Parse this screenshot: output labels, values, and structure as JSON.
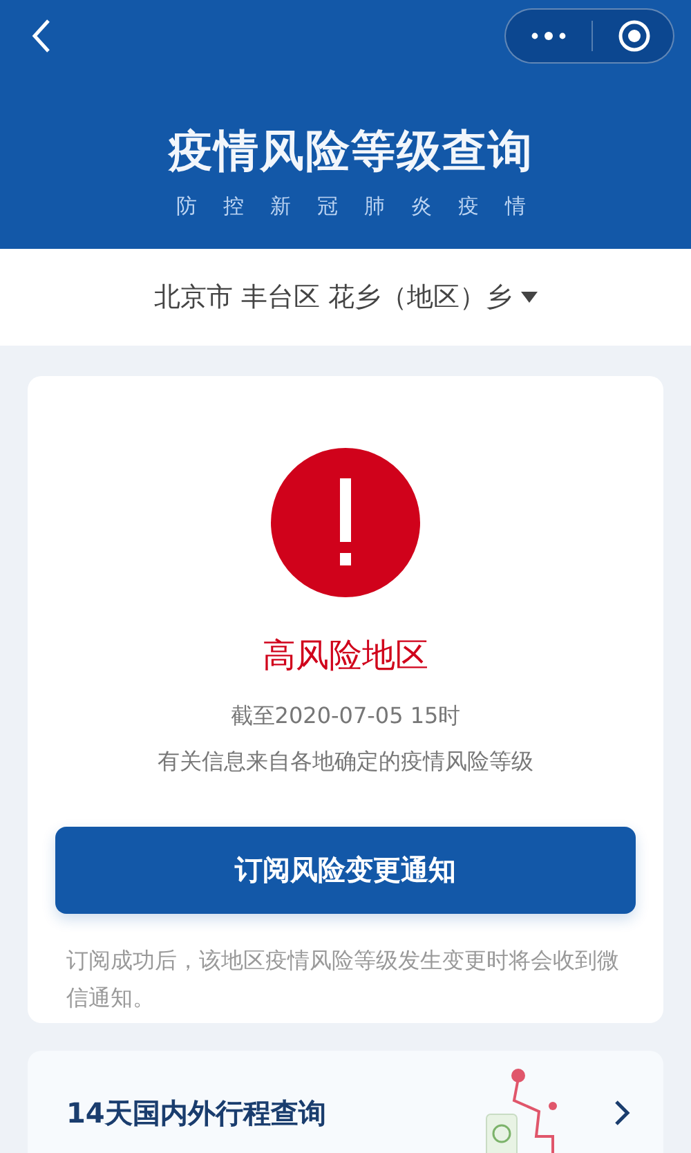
{
  "header": {
    "title": "疫情风险等级查询",
    "subtitle": [
      "防",
      "控",
      "新",
      "冠",
      "肺",
      "炎",
      "疫",
      "情"
    ]
  },
  "location": {
    "value": "北京市 丰台区 花乡（地区）乡"
  },
  "risk": {
    "kind": "high",
    "label": "高风险地区",
    "updated": "截至2020-07-05 15时",
    "source": "有关信息来自各地确定的疫情风险等级"
  },
  "subscribe": {
    "button": "订阅风险变更通知",
    "note": "订阅成功后，该地区疫情风险等级发生变更时将会收到微信通知。"
  },
  "trip_card": {
    "title": "14天国内外行程查询"
  }
}
